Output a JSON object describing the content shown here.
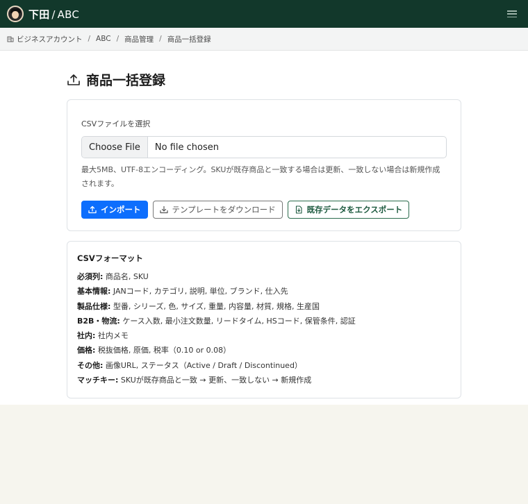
{
  "header": {
    "user": "下田",
    "separator": "/",
    "org": "ABC"
  },
  "breadcrumb": [
    {
      "label": "ビジネスアカウント"
    },
    {
      "label": "ABC"
    },
    {
      "label": "商品管理"
    },
    {
      "label": "商品一括登録"
    }
  ],
  "page": {
    "title": "商品一括登録"
  },
  "upload": {
    "label": "CSVファイルを選択",
    "choose_button": "Choose File",
    "file_status": "No file chosen",
    "help": "最大5MB、UTF-8エンコーディング。SKUが既存商品と一致する場合は更新、一致しない場合は新規作成されます。",
    "import_label": "インポート",
    "template_label": "テンプレートをダウンロード",
    "export_label": "既存データをエクスポート"
  },
  "format": {
    "title": "CSVフォーマット",
    "lines": [
      {
        "key": "必須列:",
        "value": " 商品名, SKU"
      },
      {
        "key": "基本情報:",
        "value": " JANコード, カテゴリ, 説明, 単位, ブランド, 仕入先"
      },
      {
        "key": "製品仕様:",
        "value": " 型番, シリーズ, 色, サイズ, 重量, 内容量, 材質, 規格, 生産国"
      },
      {
        "key": "B2B・物流:",
        "value": " ケース入数, 最小注文数量, リードタイム, HSコード, 保管条件, 認証"
      },
      {
        "key": "社内:",
        "value": " 社内メモ"
      },
      {
        "key": "価格:",
        "value": " 税抜価格, 原価, 税率（0.10 or 0.08）"
      },
      {
        "key": "その他:",
        "value": " 画像URL, ステータス（Active / Draft / Discontinued）"
      },
      {
        "key": "マッチキー:",
        "value": " SKUが既存商品と一致 → 更新、一致しない → 新規作成"
      }
    ]
  },
  "colors": {
    "header_bg": "#12382b",
    "primary": "#0d6efd",
    "success_outline": "#2b6b4c"
  }
}
